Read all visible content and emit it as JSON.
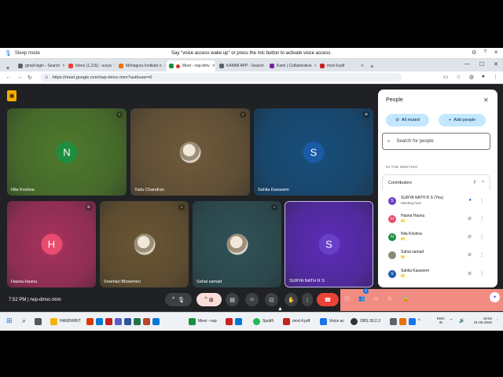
{
  "voice": {
    "sleep_label": "Sleep mode",
    "message": "Say \"voice access wake up\" or press the mic button to activate voice access."
  },
  "tabs": [
    {
      "label": "gmail login - Search",
      "color": "#5f6368"
    },
    {
      "label": "Inbox (1,115) - surya",
      "color": "#ea4335"
    },
    {
      "label": "Mohaguru Institute o",
      "color": "#e8710a"
    },
    {
      "label": "Meet - rwp-dmv",
      "color": "#1e8e3e",
      "active": true
    },
    {
      "label": "KAMMI APP - Search",
      "color": "#5f6368"
    },
    {
      "label": "Kami | Collaborative",
      "color": "#7b1fa2"
    },
    {
      "label": "mod 4.pdf",
      "color": "#c5221f"
    }
  ],
  "address": {
    "url": "https://meet.google.com/rwp-dmvc-imm?authuser=0"
  },
  "tiles": [
    {
      "name": "Nila Krishna",
      "initial": "N",
      "avatar_color": "#1e8e3e",
      "bg": "#4f7a2c",
      "kind": "initial",
      "muted_icon": "mic-on"
    },
    {
      "name": "Yadu Chandran",
      "bg": "#6f5a3a",
      "kind": "photo",
      "muted_icon": "mic-on"
    },
    {
      "name": "Sahila Kasseem",
      "initial": "S",
      "avatar_color": "#1a5aa6",
      "bg": "#174f7c",
      "kind": "initial",
      "muted_icon": "mic-off"
    },
    {
      "name": "Hasna Hasnu",
      "initial": "H",
      "avatar_color": "#e94c6f",
      "bg": "#a8325d",
      "kind": "initial",
      "muted_icon": "mic-off"
    },
    {
      "name": "Sreehari Bhowmen",
      "bg": "#6b5633",
      "kind": "photo",
      "muted_icon": "mic-on"
    },
    {
      "name": "Sahal samad",
      "bg": "#2f5257",
      "kind": "photo",
      "muted_icon": "mic-on"
    },
    {
      "name": "SURYA NATH R S",
      "initial": "S",
      "avatar_color": "#6a3fc8",
      "bg": "#5c2cb8",
      "kind": "initial",
      "muted_icon": ""
    }
  ],
  "meeting": {
    "time": "7:52 PM",
    "code": "rwp-dmvc-imm"
  },
  "panel": {
    "title": "People",
    "all_muted": "All muted",
    "add_people": "Add people",
    "search_placeholder": "Search for people",
    "in_meeting": "IN THE MEETING",
    "contributors": "Contributors",
    "count": "7",
    "people": [
      {
        "name": "SURYA NATH R S (You)",
        "sub": "Meeting host",
        "initial": "S",
        "color": "#6a3fc8",
        "act": "more"
      },
      {
        "name": "Hasna Hasnu",
        "initial": "H",
        "color": "#e94c6f",
        "act": "mic-off"
      },
      {
        "name": "Nila Krishna",
        "initial": "N",
        "color": "#1e8e3e",
        "act": "mic-off"
      },
      {
        "name": "Sahal samad",
        "initial": "",
        "color": "#8a8a7a",
        "act": "mic-off"
      },
      {
        "name": "Sahila Kasseem",
        "initial": "S",
        "color": "#1a5aa6",
        "act": "mic-off"
      }
    ]
  },
  "people_badge": "7",
  "taskbar": {
    "items": [
      {
        "label": "HANDWRIT",
        "color": "#f4b400"
      },
      {
        "label": "Meet - rwp",
        "color": "#1e8e3e"
      },
      {
        "label": "Spotifi",
        "color": "#1db954"
      },
      {
        "label": "mod 4.pdf",
        "color": "#c5221f"
      },
      {
        "label": "Voice ac",
        "color": "#1a73e8"
      },
      {
        "label": "OBS 30.2.3",
        "color": "#333333"
      }
    ],
    "lang": "ENG",
    "region": "IN",
    "clock": "19:52",
    "date": "01-05-2025"
  }
}
